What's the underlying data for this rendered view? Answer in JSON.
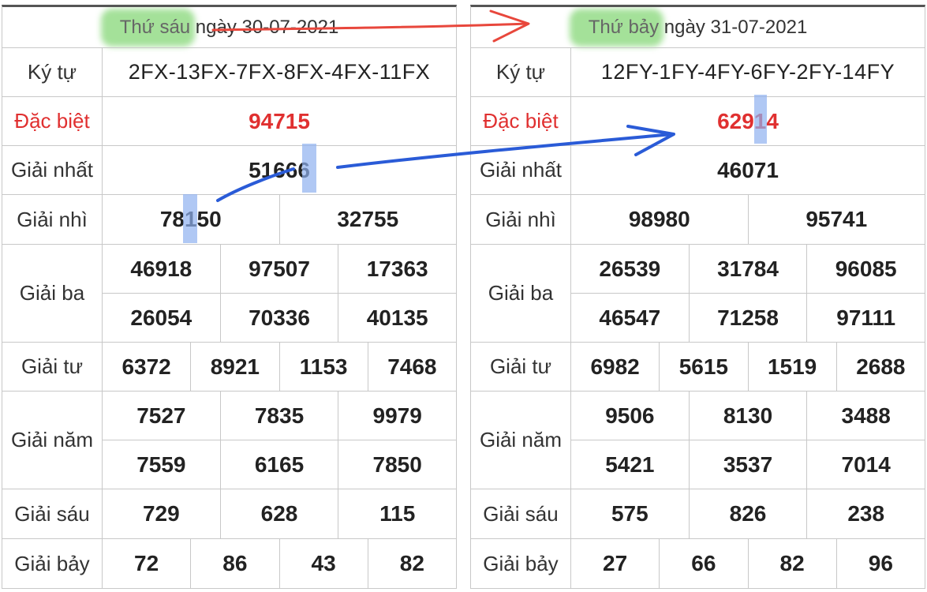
{
  "left": {
    "header": {
      "highlight": "Thứ sáu",
      "rest": " ngày 30-07-2021"
    },
    "rows": {
      "ky_tu": {
        "label": "Ký tự",
        "values": [
          "2FX-13FX-7FX-8FX-4FX-11FX"
        ]
      },
      "dac_biet": {
        "label": "Đặc biệt",
        "values": [
          "94715"
        ]
      },
      "giai_nhat": {
        "label": "Giải nhất",
        "values": [
          "51666"
        ]
      },
      "giai_nhi": {
        "label": "Giải nhì",
        "values": [
          "78150",
          "32755"
        ]
      },
      "giai_ba": {
        "label": "Giải ba",
        "values": [
          "46918",
          "97507",
          "17363",
          "26054",
          "70336",
          "40135"
        ]
      },
      "giai_tu": {
        "label": "Giải tư",
        "values": [
          "6372",
          "8921",
          "1153",
          "7468"
        ]
      },
      "giai_nam": {
        "label": "Giải năm",
        "values": [
          "7527",
          "7835",
          "9979",
          "7559",
          "6165",
          "7850"
        ]
      },
      "giai_sau": {
        "label": "Giải sáu",
        "values": [
          "729",
          "628",
          "115"
        ]
      },
      "giai_bay": {
        "label": "Giải bảy",
        "values": [
          "72",
          "86",
          "43",
          "82"
        ]
      }
    }
  },
  "right": {
    "header": {
      "highlight": "Thứ bảy",
      "rest": " ngày 31-07-2021"
    },
    "rows": {
      "ky_tu": {
        "label": "Ký tự",
        "values": [
          "12FY-1FY-4FY-6FY-2FY-14FY"
        ]
      },
      "dac_biet": {
        "label": "Đặc biệt",
        "values": [
          "62914"
        ]
      },
      "giai_nhat": {
        "label": "Giải nhất",
        "values": [
          "46071"
        ]
      },
      "giai_nhi": {
        "label": "Giải nhì",
        "values": [
          "98980",
          "95741"
        ]
      },
      "giai_ba": {
        "label": "Giải ba",
        "values": [
          "26539",
          "31784",
          "96085",
          "46547",
          "71258",
          "97111"
        ]
      },
      "giai_tu": {
        "label": "Giải tư",
        "values": [
          "6982",
          "5615",
          "1519",
          "2688"
        ]
      },
      "giai_nam": {
        "label": "Giải năm",
        "values": [
          "9506",
          "8130",
          "3488",
          "5421",
          "3537",
          "7014"
        ]
      },
      "giai_sau": {
        "label": "Giải sáu",
        "values": [
          "575",
          "826",
          "238"
        ]
      },
      "giai_bay": {
        "label": "Giải bảy",
        "values": [
          "27",
          "66",
          "82",
          "96"
        ]
      }
    }
  },
  "annotations": {
    "red_arrow_color": "#e8473c",
    "blue_arrow_color": "#2a5bd7",
    "highlight_color": "#5ac846",
    "digit_highlight_color": "#8fb0f0"
  }
}
